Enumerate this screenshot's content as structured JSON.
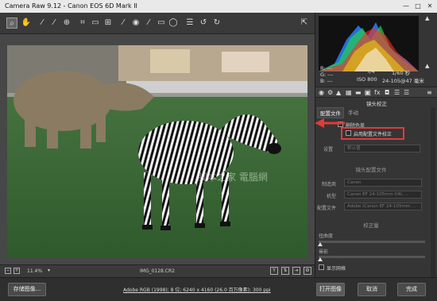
{
  "window": {
    "title": "Camera Raw 9.12 -  Canon EOS 6D Mark II",
    "minimize": "—",
    "maximize": "□",
    "close": "✕"
  },
  "toolbar": {
    "tools": [
      "zoom-icon",
      "hand-icon",
      "white-balance-icon",
      "color-sampler-icon",
      "targeted-adjustment-icon",
      "crop-icon",
      "straighten-icon",
      "transform-icon",
      "spot-removal-icon",
      "red-eye-icon",
      "adjustment-brush-icon",
      "graduated-filter-icon",
      "radial-filter-icon",
      "preferences-icon",
      "rotate-ccw-icon",
      "rotate-cw-icon"
    ],
    "fullscreen": "⇱"
  },
  "watermark": "脚本之家 電腦網",
  "status": {
    "zoom": "11.4%",
    "filename": "IMG_0128.CR2"
  },
  "info": {
    "r": "R: ---",
    "g": "G: ---",
    "b": "B: ---",
    "f": "f/4",
    "shutter": "1/60 秒",
    "iso": "ISO 800",
    "lens": "24-105@47 毫米"
  },
  "panel": {
    "title": "镜头校正",
    "tabs": [
      "配置文件",
      "手动"
    ],
    "remove_ca": "删除色差",
    "enable_profile": "启用配置文件校正",
    "setup_label": "设置",
    "setup_value": "默认值",
    "profile_header": "镜头配置文件",
    "maker_label": "制造商",
    "maker_value": "Canon",
    "model_label": "机型",
    "model_value": "Canon EF 24-105mm f/4L ...",
    "profile_label": "配置文件",
    "profile_value": "Adobe (Canon EF 24-105mm ...",
    "correction_header": "校正量",
    "distortion_label": "扭曲度",
    "vignette_label": "晕影",
    "grid_label": "显示网格"
  },
  "footer": {
    "save": "存储图像...",
    "info_link": "Adobe RGB (1998); 8 位; 6240 x 4160 (26.0 百万像素); 300 ppi",
    "open": "打开图像",
    "cancel": "取消",
    "done": "完成"
  },
  "colors": {
    "highlight": "#e23a3a",
    "panel": "#353535"
  }
}
